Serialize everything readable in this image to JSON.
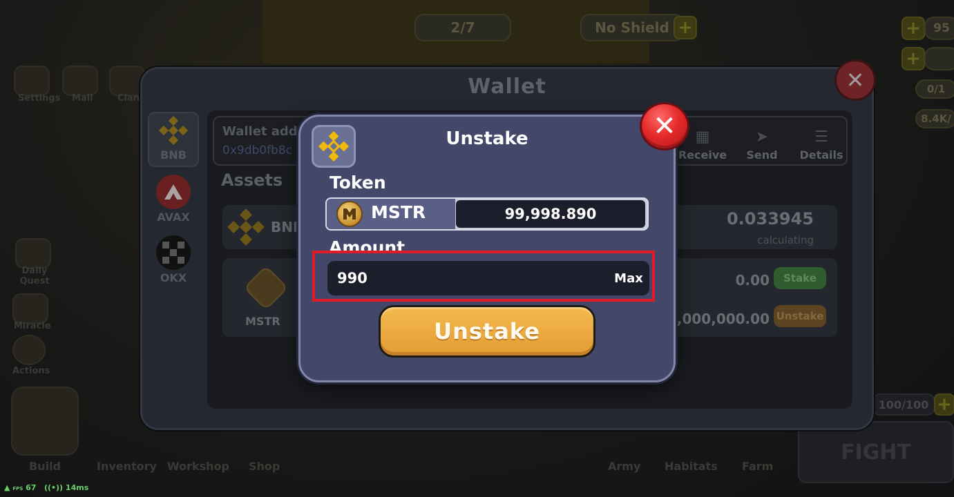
{
  "hud": {
    "wave": "2/7",
    "shield": "No Shield",
    "resource_1": "95",
    "resource_2": "0/1",
    "resource_3": "8.4K/",
    "energy": "100/100",
    "fight_label": "FIGHT",
    "fps_label": "FPS",
    "fps_value": "67",
    "ping": "14ms"
  },
  "left_menu": [
    "Settings",
    "Mail",
    "Clan",
    "Daily Quest",
    "Miracle",
    "Actions"
  ],
  "bottom_menu": [
    "Build",
    "Inventory",
    "Workshop",
    "Shop",
    "Army",
    "Habitats",
    "Farm"
  ],
  "wallet": {
    "title": "Wallet",
    "chains": [
      {
        "label": "BNB",
        "active": true
      },
      {
        "label": "AVAX",
        "active": false
      },
      {
        "label": "OKX",
        "active": false
      }
    ],
    "address_label": "Wallet addr",
    "address_value": "0x9db0fb8c",
    "actions": [
      "Receive",
      "Send",
      "Details"
    ],
    "assets_title": "Assets",
    "bnb_asset": {
      "name": "BNI",
      "amount": "0.033945",
      "sub": "calculating"
    },
    "mstr_asset": {
      "name": "MSTR",
      "staked_value": "0.00",
      "stake_label": "Stake",
      "unstaked_value": "1,000,000.00",
      "unstake_label": "Unstake"
    }
  },
  "modal": {
    "title": "Unstake",
    "token_label": "Token",
    "token_name": "MSTR",
    "token_balance": "99,998.890",
    "amount_label": "Amount",
    "amount_value": "990",
    "max_label": "Max",
    "submit_label": "Unstake"
  },
  "colors": {
    "modal_bg": "#434769",
    "button_orange": "#f4b94e",
    "close_red": "#e52a2a",
    "highlight_red": "#e01a26",
    "bnb_gold": "#f0b90b",
    "stake_green": "#4caf50"
  }
}
